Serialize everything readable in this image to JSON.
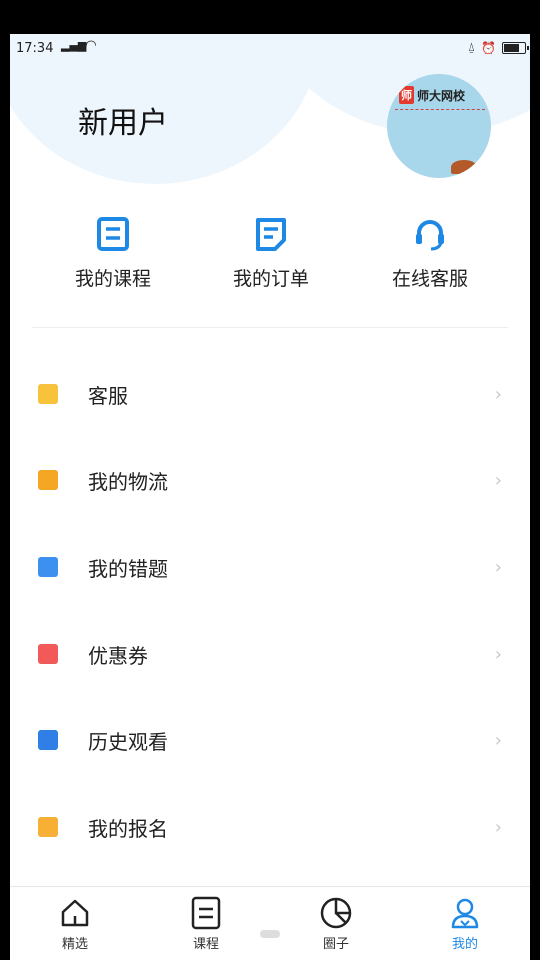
{
  "status": {
    "time": "17:34",
    "signal": "4G",
    "wifi": "wifi",
    "icons": [
      "alarm-icon",
      "clock-icon",
      "battery-icon"
    ]
  },
  "profile": {
    "username": "新用户",
    "avatar_brand_mark": "师",
    "avatar_brand": "师大网校"
  },
  "quick_actions": [
    {
      "label": "我的课程",
      "icon": "course-icon"
    },
    {
      "label": "我的订单",
      "icon": "order-icon"
    },
    {
      "label": "在线客服",
      "icon": "headset-icon"
    }
  ],
  "menu": [
    {
      "label": "客服",
      "icon": "service-icon",
      "color": "#f7c23c"
    },
    {
      "label": "我的物流",
      "icon": "logistics-icon",
      "color": "#f5a623"
    },
    {
      "label": "我的错题",
      "icon": "wrong-questions-icon",
      "color": "#3d8ff0"
    },
    {
      "label": "优惠券",
      "icon": "coupon-icon",
      "color": "#f25a5a"
    },
    {
      "label": "历史观看",
      "icon": "history-icon",
      "color": "#2f7fe6"
    },
    {
      "label": "我的报名",
      "icon": "registration-icon",
      "color": "#f7b035"
    }
  ],
  "chevron": "›",
  "tabs": [
    {
      "label": "精选",
      "icon": "home-icon",
      "active": false
    },
    {
      "label": "课程",
      "icon": "course-list-icon",
      "active": false
    },
    {
      "label": "圈子",
      "icon": "circle-chart-icon",
      "active": false
    },
    {
      "label": "我的",
      "icon": "profile-icon",
      "active": true
    }
  ],
  "colors": {
    "accent": "#1e88e5",
    "background_blob": "#eef6fd"
  }
}
